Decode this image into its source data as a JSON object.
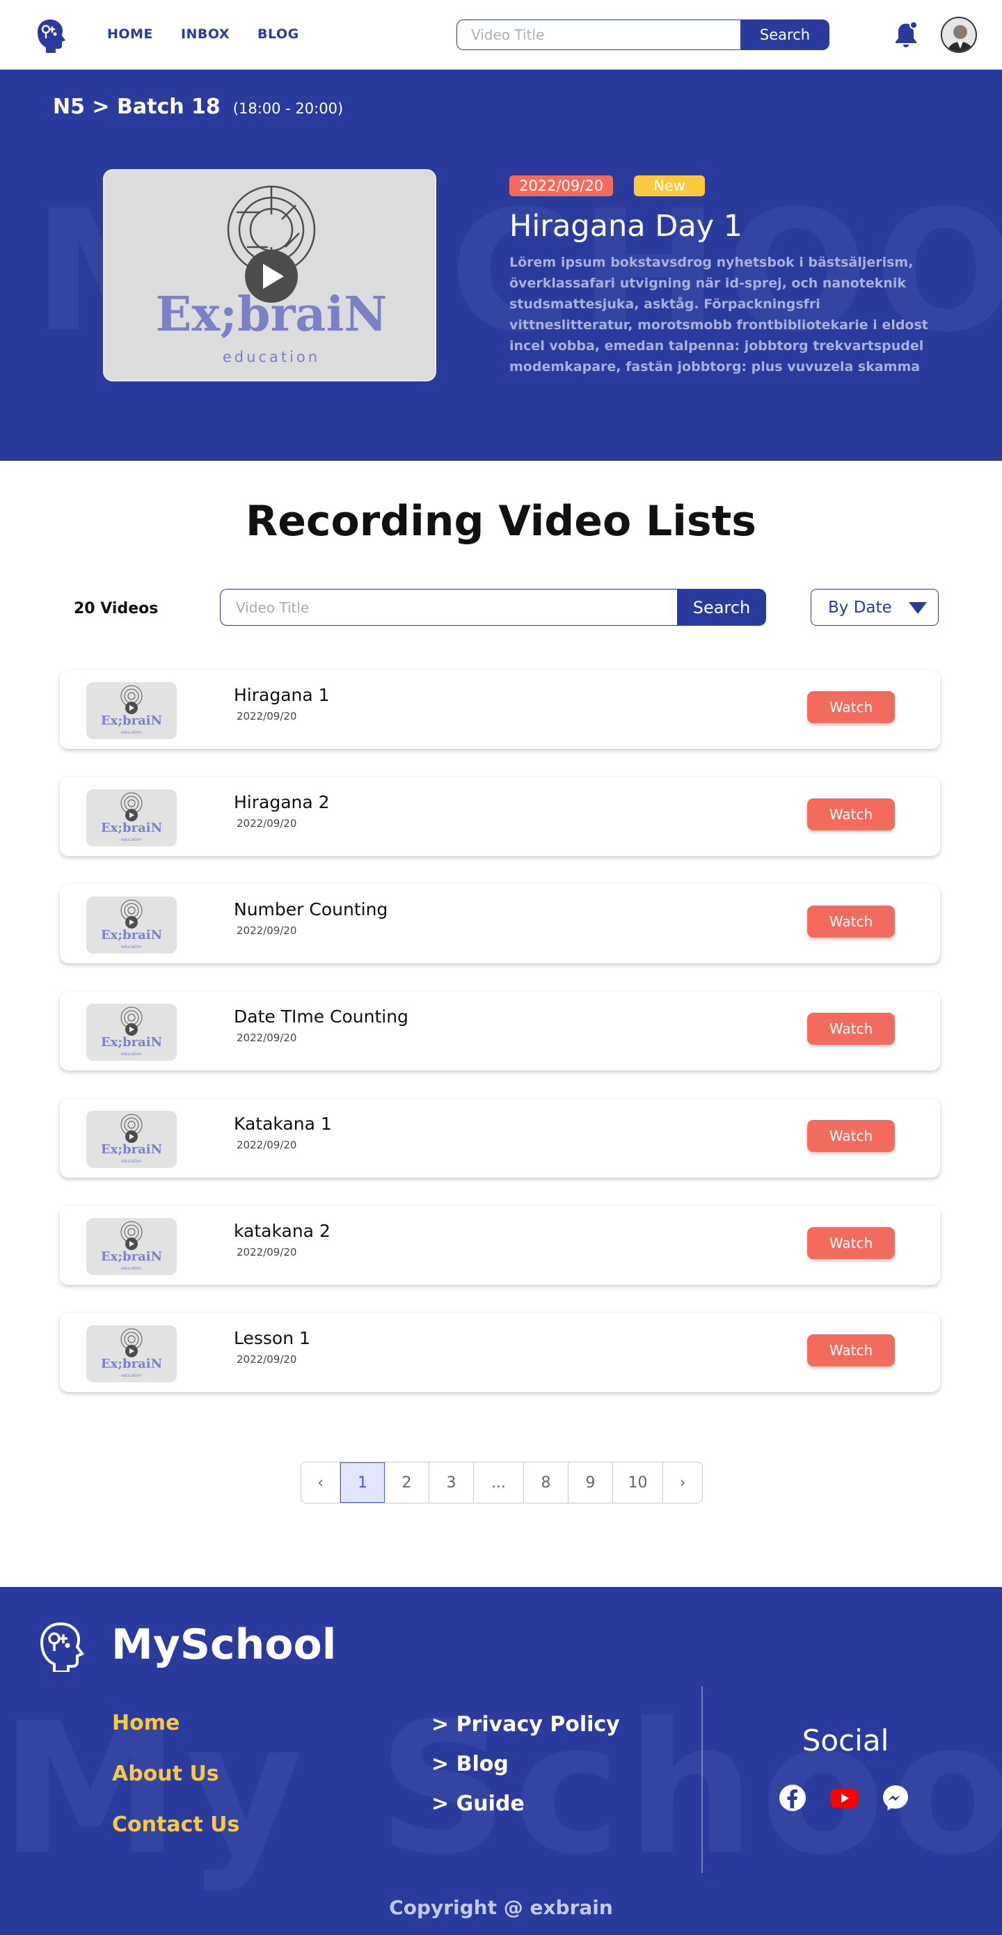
{
  "header": {
    "nav": [
      {
        "label": "HOME"
      },
      {
        "label": "INBOX"
      },
      {
        "label": "BLOG"
      }
    ],
    "search": {
      "placeholder": "Video Title",
      "button_label": "Search"
    },
    "icons": {
      "logo": "brain-head-icon",
      "bell": "bell-icon",
      "avatar": "user-avatar"
    }
  },
  "hero": {
    "breadcrumb": "N5 > Batch 18",
    "time": "(18:00 - 20:00)",
    "watermark": "MySCHOOL",
    "thumbnail": {
      "logo_text": "Ex;braiN",
      "logo_sub": "education"
    },
    "date_badge": "2022/09/20",
    "new_badge": "New",
    "title": "Hiragana Day 1",
    "description": "Lörem ipsum bokstavsdrog nyhetsbok i bästsäljerism, överklassafari utvigning när id-sprej, och nanoteknik studsmattesjuka, asktåg. Förpackningsfri vittneslitteratur, morotsmobb frontbibliotekarie i eldost incel vobba, emedan talpenna: jobbtorg trekvartspudel modemkapare, fastän jobbtorg: plus vuvuzela skamma klittra halvtaktsjobb dra åt"
  },
  "list_section": {
    "title": "Recording Video Lists",
    "count": "20 Videos",
    "search": {
      "placeholder": "Video Title",
      "button_label": "Search"
    },
    "sort": {
      "selected": "By Date"
    }
  },
  "videos": [
    {
      "title": "Hiragana 1",
      "date": "2022/09/20",
      "action": "Watch"
    },
    {
      "title": "Hiragana 2",
      "date": "2022/09/20",
      "action": "Watch"
    },
    {
      "title": "Number Counting",
      "date": "2022/09/20",
      "action": "Watch"
    },
    {
      "title": "Date TIme Counting",
      "date": "2022/09/20",
      "action": "Watch"
    },
    {
      "title": "Katakana 1",
      "date": "2022/09/20",
      "action": "Watch"
    },
    {
      "title": "katakana 2",
      "date": "2022/09/20",
      "action": "Watch"
    },
    {
      "title": "Lesson 1",
      "date": "2022/09/20",
      "action": "Watch"
    }
  ],
  "thumb_logo": {
    "text": "Ex;braiN",
    "sub": "education"
  },
  "pagination": {
    "prev": "‹",
    "pages": [
      "1",
      "2",
      "3",
      "...",
      "8",
      "9",
      "10"
    ],
    "current": "1",
    "next": "›"
  },
  "footer": {
    "brand": "MySchool",
    "watermark": "My School",
    "links_primary": [
      "Home",
      "About Us",
      "Contact Us"
    ],
    "links_secondary": [
      "> Privacy Policy",
      "> Blog",
      "> Guide"
    ],
    "social_title": "Social",
    "social_icons": [
      "facebook-icon",
      "youtube-icon",
      "messenger-icon"
    ],
    "copyright": "Copyright @ exbrain"
  },
  "colors": {
    "primary": "#2a3a9d",
    "accent": "#f26b5c",
    "highlight": "#fbc93d",
    "thumb_bg": "#dcdcdc"
  }
}
